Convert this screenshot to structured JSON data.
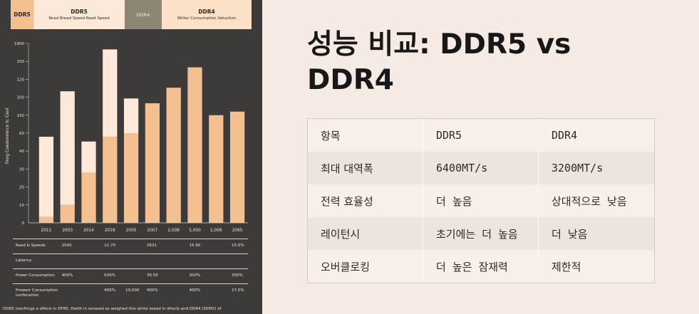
{
  "legend": {
    "item1": {
      "title": "DDR5"
    },
    "item2": {
      "title": "DDR5",
      "subtitle": "Read Bread Speed Read Speed"
    },
    "item3": {
      "title": "DDR4"
    },
    "item4": {
      "title": "DDR4",
      "subtitle": "Writer Consumption Vatuction"
    }
  },
  "colors": {
    "orange": "#f5c08f",
    "cream": "#fde9d9",
    "gray": "#8c8774",
    "background": "#3c3b39"
  },
  "chart_data": {
    "type": "bar",
    "ylabel": "Feog Coeonnrence tc Ceol",
    "y_tick_labels": [
      "0",
      "10",
      "20",
      "30",
      "40",
      "60",
      "150",
      "100",
      "120",
      "150",
      "1900"
    ],
    "categories": [
      "2011",
      "2003",
      "2014",
      "2016",
      "2005",
      "2007",
      "2,008",
      "5,000",
      "2,006",
      "2065"
    ],
    "series": [
      {
        "name": "DDR5",
        "values": [
          0.5,
          1.5,
          4.2,
          7.2,
          7.5,
          10.0,
          11.3,
          13.0,
          9.0,
          9.3
        ]
      },
      {
        "name": "DDR5",
        "values": [
          6.7,
          9.5,
          2.6,
          7.3,
          2.9,
          0,
          0,
          0,
          0,
          0
        ]
      }
    ],
    "ylim": [
      0,
      15
    ]
  },
  "table": {
    "rows": [
      {
        "label": "Read & Speeds",
        "cells": [
          {
            "col": 1,
            "text": "2500"
          },
          {
            "col": 3,
            "text": "11.70"
          },
          {
            "col": 5,
            "text": "2631"
          },
          {
            "col": 7,
            "text": "15.90"
          },
          {
            "col": 9,
            "text": "15.0%"
          }
        ]
      },
      {
        "label": "Latency:",
        "cells": []
      },
      {
        "label": "Power Consumption",
        "cells": [
          {
            "col": 1,
            "text": "400%"
          },
          {
            "col": 3,
            "text": "630%"
          },
          {
            "col": 5,
            "text": "39.59"
          },
          {
            "col": 7,
            "text": "300%"
          },
          {
            "col": 9,
            "text": "300%"
          }
        ]
      },
      {
        "label": "Prowerr Consumption Lonfecation",
        "cells": [
          {
            "col": 3,
            "text": "400%"
          },
          {
            "col": 4,
            "text": "10,000"
          },
          {
            "col": 5,
            "text": "400%"
          },
          {
            "col": 7,
            "text": "400%"
          },
          {
            "col": 9,
            "text": "17.0%"
          }
        ]
      }
    ]
  },
  "footnote": "DDR5 (eecfnngs a offece in DFR5, Dwith in norased as weighed this white seeed in dhecls and DDR4 (DDR5) of",
  "title": "성능 비교: DDR5 vs DDR4",
  "comparison": {
    "header": [
      "항목",
      "DDR5",
      "DDR4"
    ],
    "rows": [
      [
        "최대 대역폭",
        "6400MT/s",
        "3200MT/s"
      ],
      [
        "전력 효율성",
        "더 높음",
        "상대적으로 낮음"
      ],
      [
        "레이턴시",
        "초기에는 더 높음",
        "더 낮음"
      ],
      [
        "오버클로킹",
        "더 높은 잠재력",
        "제한적"
      ]
    ]
  }
}
